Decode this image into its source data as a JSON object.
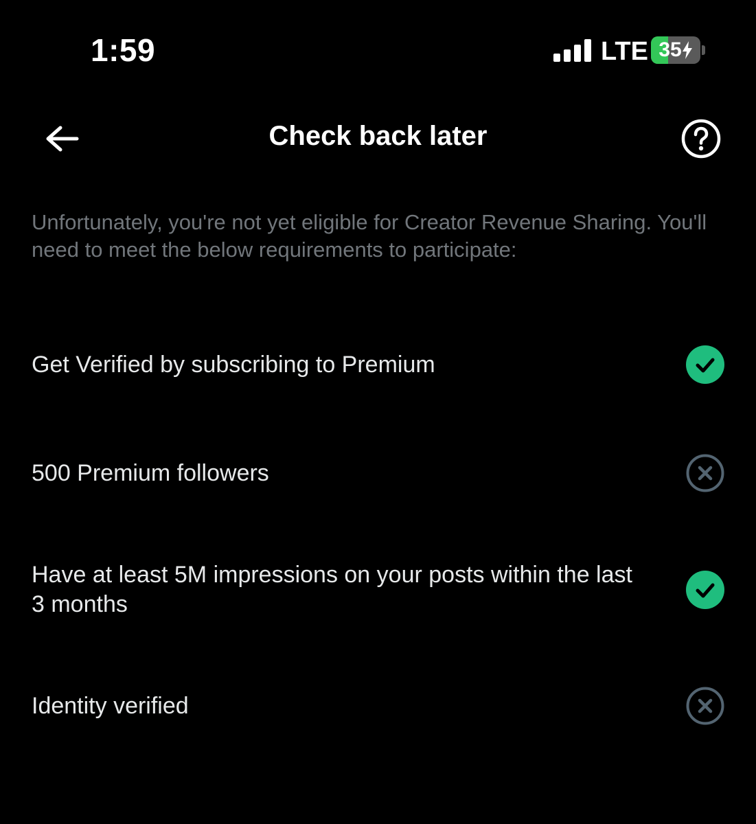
{
  "status_bar": {
    "time": "1:59",
    "network": "LTE",
    "battery_level": "35",
    "battery_fraction": 0.35,
    "battery_charging": true
  },
  "header": {
    "title": "Check back later",
    "back_icon": "arrow-left-icon",
    "help_icon": "question-circle-icon"
  },
  "intro_text": "Unfortunately, you're not yet eligible for Creator Revenue Sharing. You'll need to meet the below requirements to participate:",
  "requirements": [
    {
      "label": "Get Verified by subscribing to Premium",
      "met": true,
      "icon": "check-circle-icon"
    },
    {
      "label": "500 Premium followers",
      "met": false,
      "icon": "x-circle-icon"
    },
    {
      "label": "Have at least 5M impressions on your posts within the last 3 months",
      "met": true,
      "icon": "check-circle-icon"
    },
    {
      "label": "Identity verified",
      "met": false,
      "icon": "x-circle-icon"
    }
  ],
  "colors": {
    "background": "#000000",
    "met": "#1fbd7e",
    "unmet": "#536471",
    "muted_text": "#71767b",
    "battery_green": "#33c758"
  }
}
